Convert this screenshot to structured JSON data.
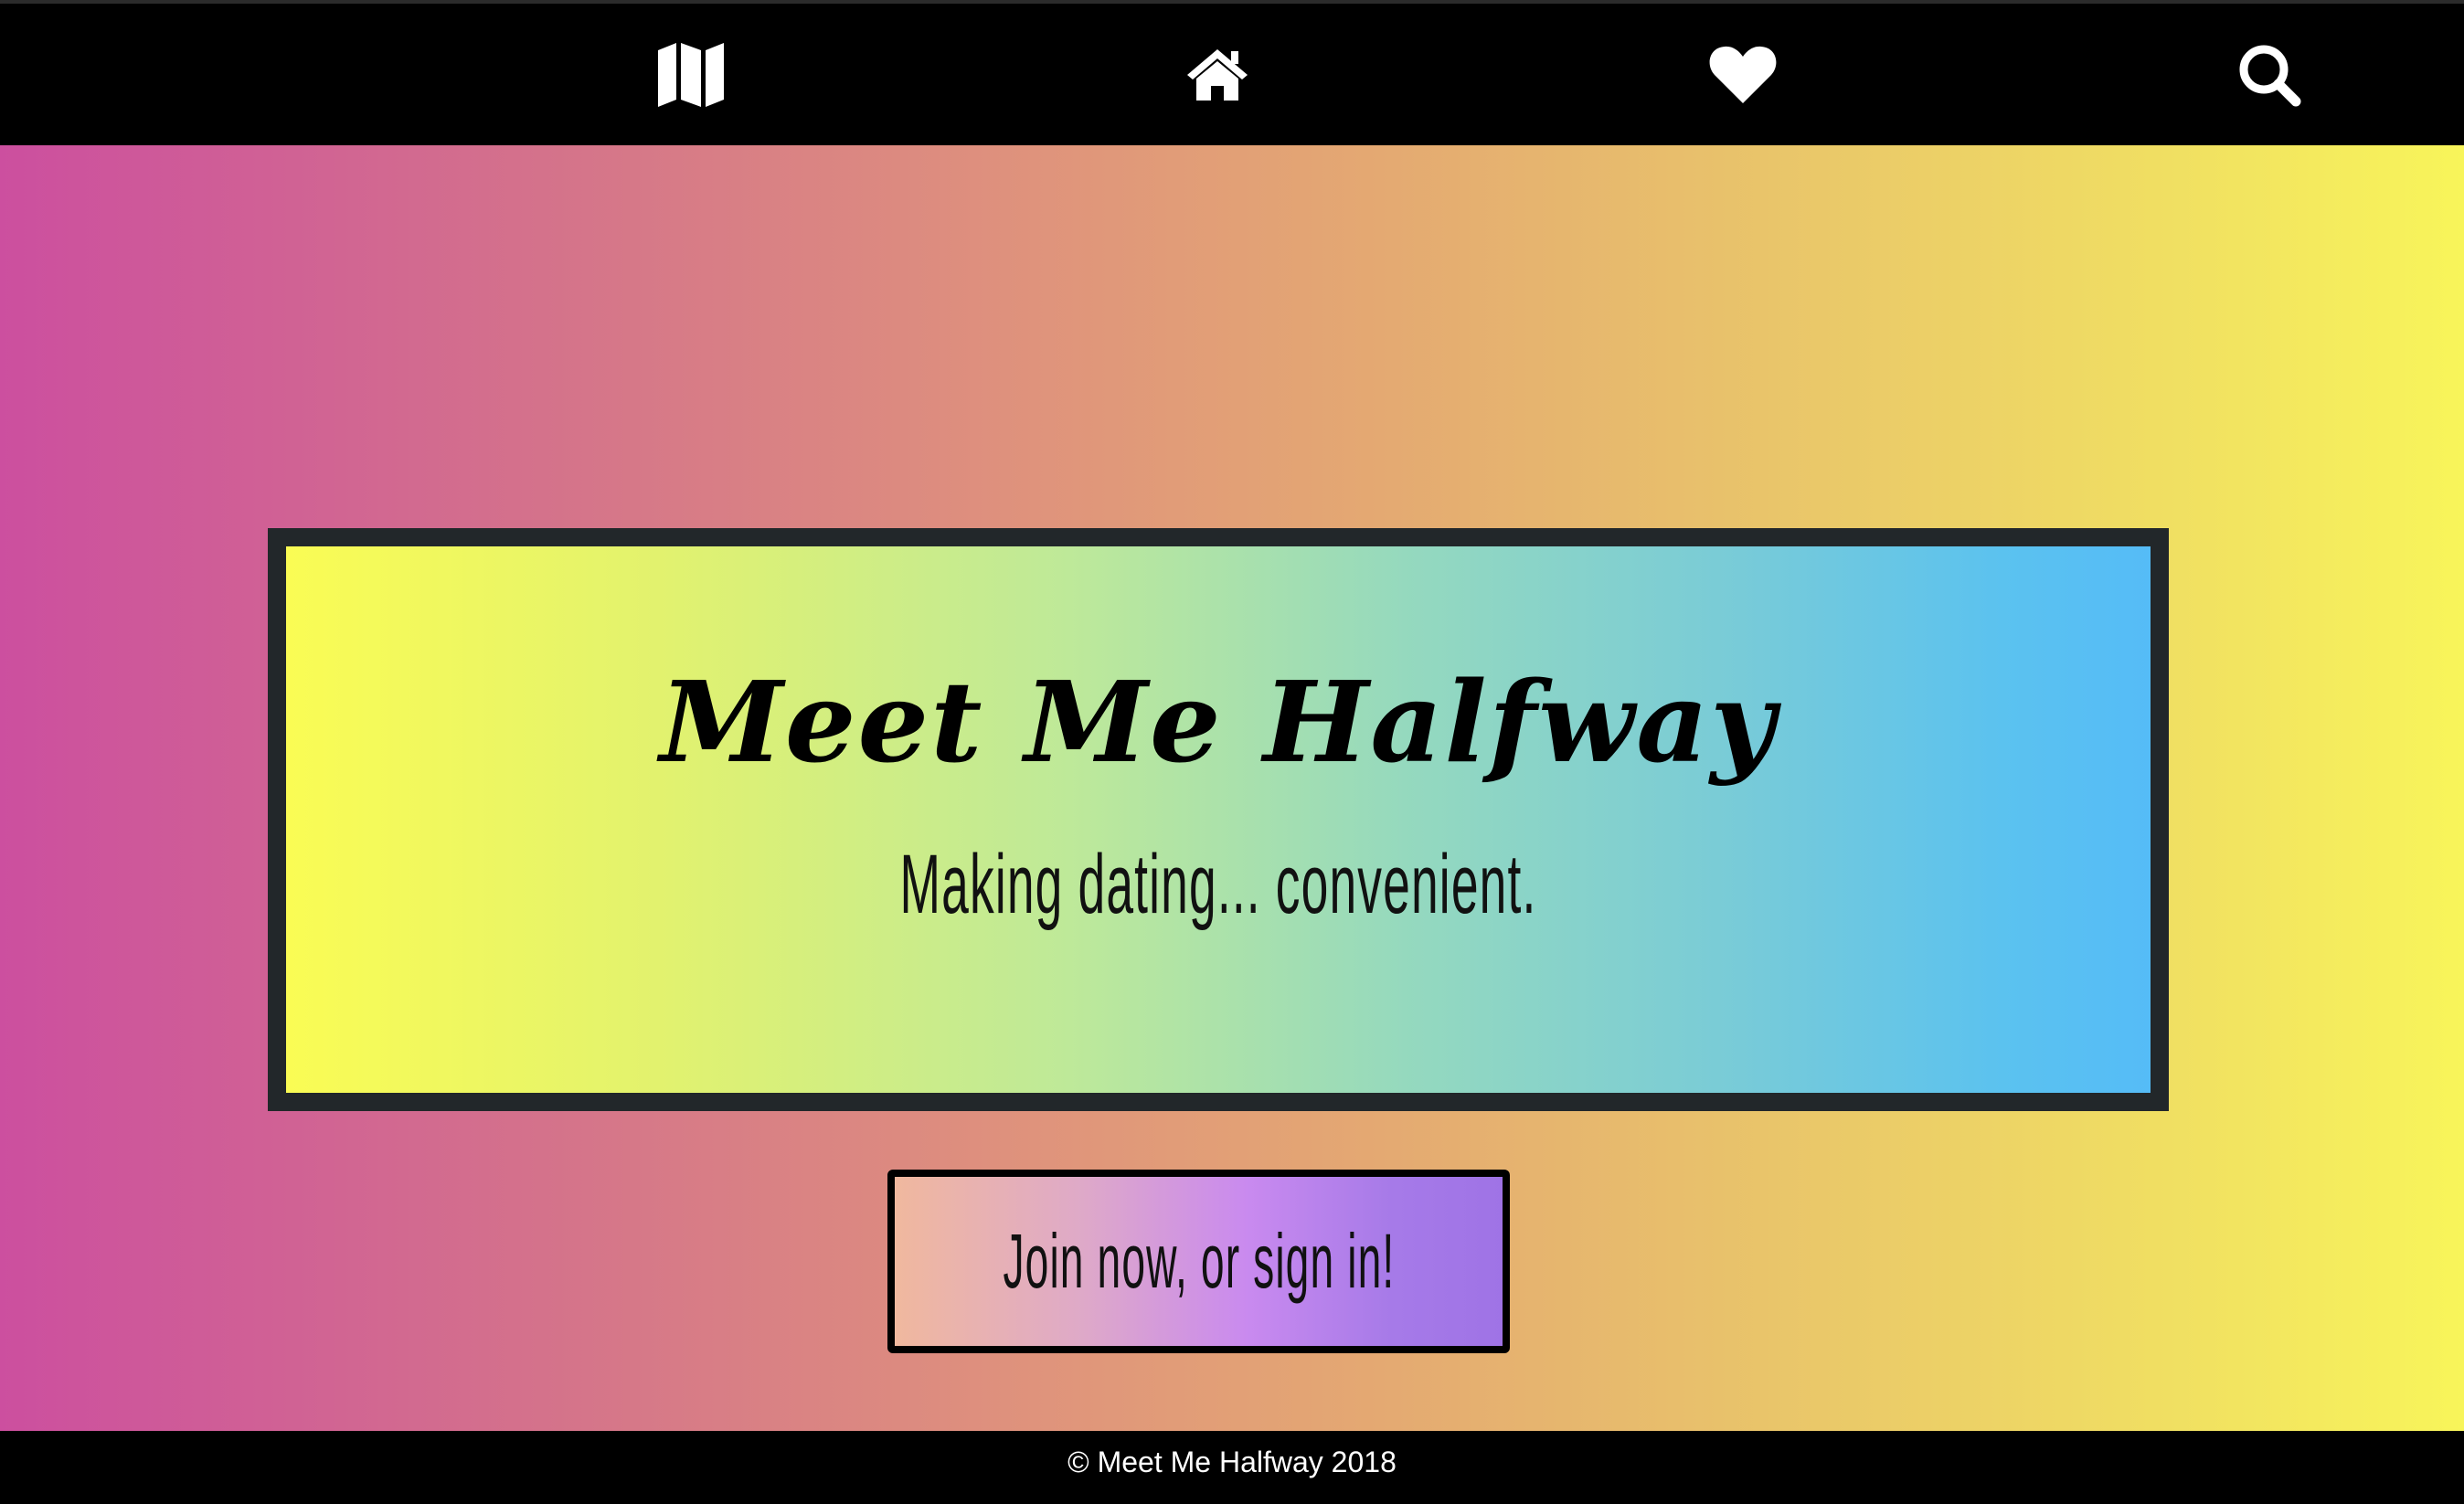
{
  "nav": {
    "icons": [
      "map-icon",
      "home-icon",
      "heart-icon",
      "search-icon"
    ]
  },
  "hero": {
    "title": "Meet Me Halfway",
    "subtitle": "Making dating... convenient.",
    "cta_label": "Join now, or sign in!"
  },
  "footer": {
    "copyright": "© Meet Me Halfway 2018"
  },
  "colors": {
    "navbar": "#000000",
    "banner_border": "#22272a",
    "hero_gradient_start": "#cc4f9f",
    "hero_gradient_end": "#f8f55a",
    "banner_gradient_start": "#fafc54",
    "banner_gradient_end": "#55bcf7",
    "cta_gradient_start": "#f0b89e",
    "cta_gradient_end": "#9f73e6"
  }
}
